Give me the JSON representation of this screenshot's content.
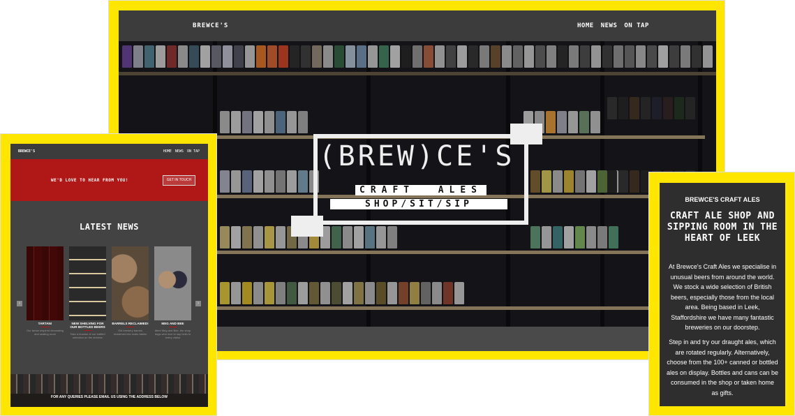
{
  "main": {
    "brand": "BREWCE'S",
    "nav": [
      "HOME",
      "NEWS",
      "ON TAP"
    ],
    "logo": {
      "title": "(BREW)CE'S",
      "craft_words": [
        "CRAFT",
        "ALES"
      ],
      "tagline": "SHOP/SIT/SIP"
    }
  },
  "mobile": {
    "brand": "BREWCE'S",
    "nav": [
      "HOME",
      "NEWS",
      "ON TAP"
    ],
    "banner_text": "WE'D LOVE TO HEAR FROM YOU!",
    "banner_button": "GET IN TOUCH",
    "section_title": "LATEST NEWS",
    "cards": [
      {
        "title": "TARTAN!",
        "desc": "Our tartan inspired decorating and seating room"
      },
      {
        "title": "NEW SHELVING FOR OUR BOTTLED BEERS",
        "desc": "Take a browse of our bottled selection on the shelves"
      },
      {
        "title": "BARRELS RECLAIMED!",
        "desc": "Old brewery barrels reclaimed into rustic tables"
      },
      {
        "title": "MEG AND BEE",
        "desc": "Meet Meg and Bee, the shop dogs who love to say hello to every visitor"
      }
    ],
    "footer_text": "FOR ANY QUERIES PLEASE EMAIL US USING THE ADDRESS BELOW"
  },
  "side": {
    "brand": "BREWCE'S CRAFT ALES",
    "heading": "CRAFT ALE SHOP AND SIPPING ROOM IN THE HEART OF LEEK",
    "para1": "At Brewce's Craft Ales we specialise in unusual beers from around the world. We stock a wide selection of British beers, especially those from the local area. Being based in Leek, Staffordshire we have many fantastic breweries on our doorstep.",
    "para2": "Step in and try our draught ales, which are rotated regularly. Alternatively, choose from the 100+ canned or bottled ales on display. Bottles and cans can be consumed in the shop or taken home as gifts."
  },
  "colors": {
    "frame": "#ffe600",
    "red_banner": "#b01818",
    "dark": "#3a3a3a"
  }
}
